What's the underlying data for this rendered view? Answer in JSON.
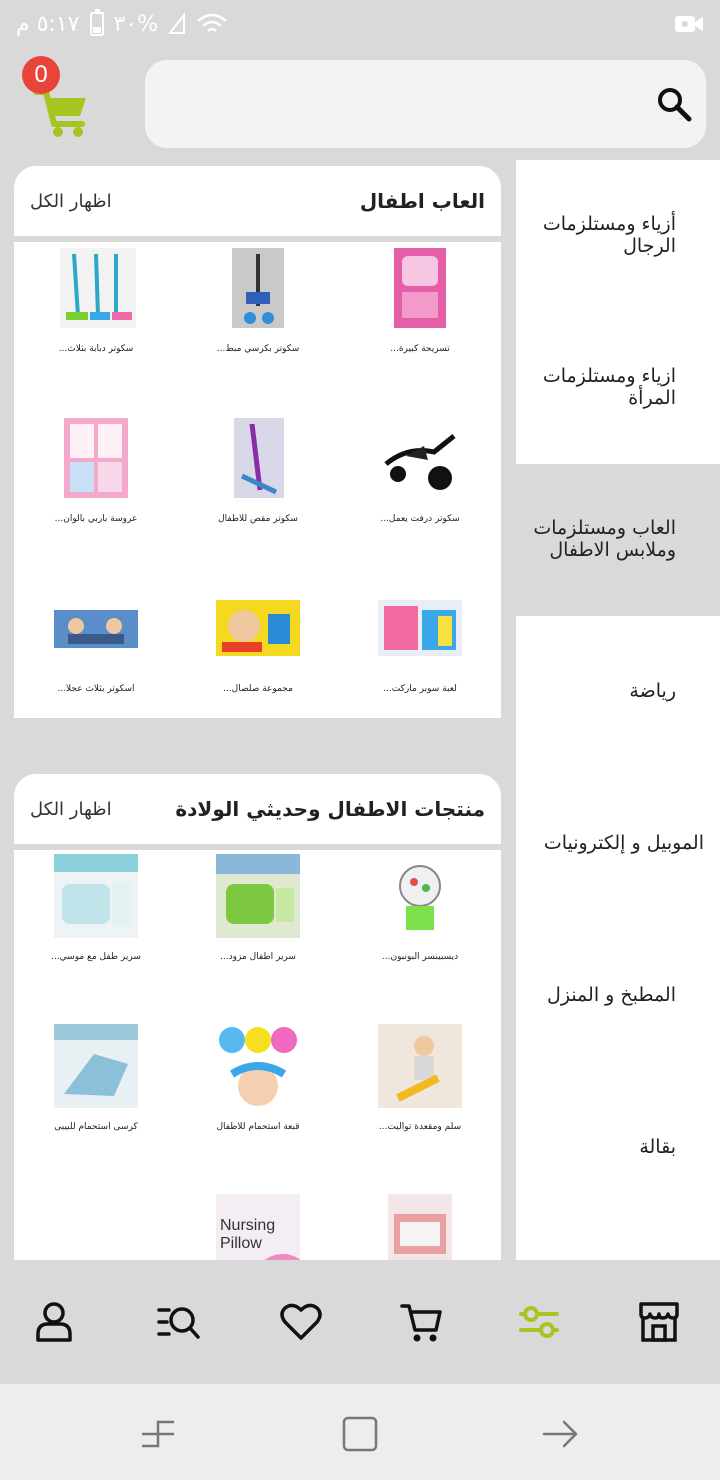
{
  "status_bar": {
    "time": "٥:١٧ م",
    "battery": "٣٠%",
    "battery_level": 0.3
  },
  "header": {
    "cart_count": "0",
    "search_placeholder": ""
  },
  "sidebar": {
    "items": [
      {
        "label": "أزياء ومستلزمات الرجال",
        "active": false
      },
      {
        "label": "ازياء ومستلزمات المرأة",
        "active": false
      },
      {
        "label": "العاب ومستلزمات وملابس الاطفال",
        "active": true
      },
      {
        "label": "رياضة",
        "active": false
      },
      {
        "label": "الموبيل و إلكترونيات",
        "active": false
      },
      {
        "label": "المطبخ و المنزل",
        "active": false
      },
      {
        "label": "بقالة",
        "active": false
      }
    ]
  },
  "sections": [
    {
      "title": "العاب اطفال",
      "show_all": "اظهار الكل",
      "products": [
        {
          "name": "تسريحة كبيرة..."
        },
        {
          "name": "سكوتر بكرسي مبط..."
        },
        {
          "name": "سكوتر دبابة بثلاث..."
        },
        {
          "name": "سكوتر درفت يعمل..."
        },
        {
          "name": "سكوتر مقص للاطفال"
        },
        {
          "name": "عروسة باربي بالوان..."
        },
        {
          "name": "لعبة سوبر ماركت..."
        },
        {
          "name": "مجموعة صلصال..."
        },
        {
          "name": "اسكوتر بثلاث عجلا..."
        }
      ]
    },
    {
      "title": "منتجات الاطفال وحديثي الولادة",
      "show_all": "اظهار الكل",
      "products": [
        {
          "name": "ديسبينسر البونبون..."
        },
        {
          "name": "سرير اطفال مزود..."
        },
        {
          "name": "سرير طفل مع موسي..."
        },
        {
          "name": "سلم ومقعدة تواليت..."
        },
        {
          "name": "قبعة استحمام للاطفال"
        },
        {
          "name": "كرسى استحمام للبيبى"
        },
        {
          "name": ""
        },
        {
          "name": ""
        }
      ]
    }
  ],
  "colors": {
    "accent": "#a7c520",
    "badge": "#e8443a",
    "background": "#d9d9d9"
  },
  "bottom_nav": [
    {
      "icon": "store-icon",
      "active": false
    },
    {
      "icon": "filter-icon",
      "active": true
    },
    {
      "icon": "cart-icon",
      "active": false
    },
    {
      "icon": "heart-icon",
      "active": false
    },
    {
      "icon": "search-list-icon",
      "active": false
    },
    {
      "icon": "user-icon",
      "active": false
    }
  ],
  "image_text": {
    "nursing_pillow": "Nursing Pillow"
  }
}
